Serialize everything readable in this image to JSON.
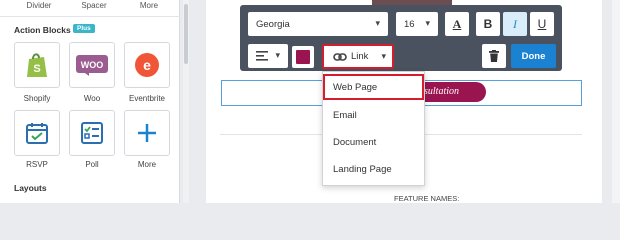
{
  "left_panel": {
    "top_labels": [
      "Divider",
      "Spacer",
      "More"
    ],
    "section_title": "Action Blocks",
    "badge": "Plus",
    "tiles": [
      {
        "label": "Shopify",
        "icon": "shopify-icon"
      },
      {
        "label": "Woo",
        "icon": "woo-icon"
      },
      {
        "label": "Eventbrite",
        "icon": "eventbrite-icon"
      },
      {
        "label": "RSVP",
        "icon": "rsvp-icon"
      },
      {
        "label": "Poll",
        "icon": "poll-icon"
      },
      {
        "label": "More",
        "icon": "plus-icon"
      }
    ],
    "layouts_title": "Layouts"
  },
  "toolbar": {
    "font_family": "Georgia",
    "font_size": "16",
    "font_color_glyph": "A",
    "bold_glyph": "B",
    "italic_glyph": "I",
    "underline_glyph": "U",
    "link_label": "Link",
    "done_label": "Done",
    "text_color": "#9a1550"
  },
  "link_menu": {
    "items": [
      "Web Page",
      "Email",
      "Document",
      "Landing Page"
    ]
  },
  "canvas": {
    "button_text": "sultation",
    "footer_text": "FEATURE NAMES:"
  },
  "colors": {
    "accent": "#1a82d1",
    "highlight": "#d41e2e",
    "brand_button": "#9a1550"
  }
}
